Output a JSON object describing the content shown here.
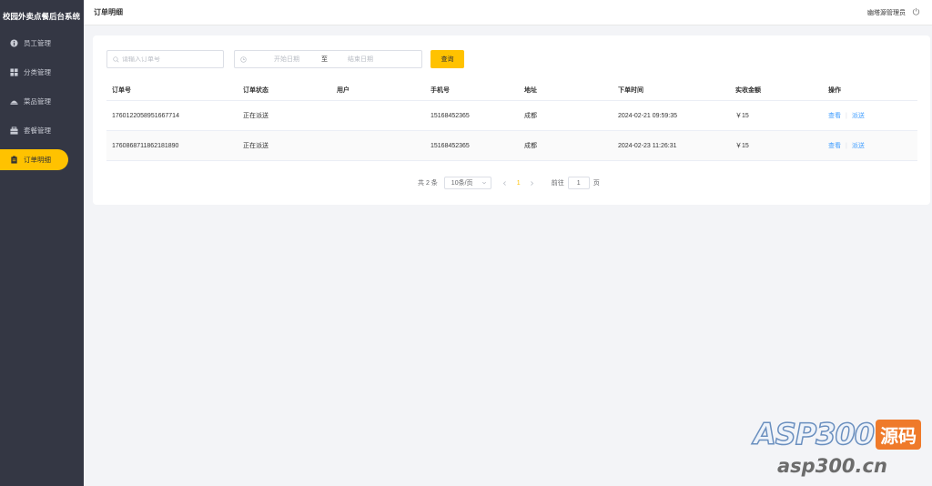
{
  "app": {
    "title": "校园外卖点餐后台系统"
  },
  "sidebar": {
    "items": [
      {
        "label": "员工管理",
        "icon": "info-icon",
        "active": false
      },
      {
        "label": "分类管理",
        "icon": "grid-icon",
        "active": false
      },
      {
        "label": "菜品管理",
        "icon": "dish-icon",
        "active": false
      },
      {
        "label": "套餐管理",
        "icon": "package-icon",
        "active": false
      },
      {
        "label": "订单明细",
        "icon": "clipboard-icon",
        "active": true
      }
    ]
  },
  "header": {
    "title": "订单明细",
    "user": "幽塔源管理员",
    "power_icon": "power-icon"
  },
  "filters": {
    "search_placeholder": "请输入订单号",
    "date_start_placeholder": "开始日期",
    "date_separator": "至",
    "date_end_placeholder": "结束日期",
    "query_label": "查询"
  },
  "table": {
    "columns": [
      "订单号",
      "订单状态",
      "用户",
      "手机号",
      "地址",
      "下单时间",
      "实收金额",
      "操作"
    ],
    "rows": [
      {
        "order_no": "1760122058951667714",
        "status": "正在派送",
        "user": "",
        "phone": "15168452365",
        "address": "成都",
        "time": "2024-02-21 09:59:35",
        "amount": "￥15",
        "actions": [
          "查看",
          "派送"
        ]
      },
      {
        "order_no": "1760868711862181890",
        "status": "正在派送",
        "user": "",
        "phone": "15168452365",
        "address": "成都",
        "time": "2024-02-23 11:26:31",
        "amount": "￥15",
        "actions": [
          "查看",
          "派送"
        ]
      }
    ]
  },
  "pagination": {
    "total": "共 2 条",
    "page_size": "10条/页",
    "current_page": "1",
    "goto_label": "前往",
    "goto_value": "1",
    "goto_suffix": "页"
  },
  "watermark": {
    "brand": "ASP300",
    "badge": "源码",
    "url": "asp300.cn"
  },
  "colors": {
    "accent": "#ffc200",
    "sidebar": "#343744",
    "link": "#419eff"
  }
}
